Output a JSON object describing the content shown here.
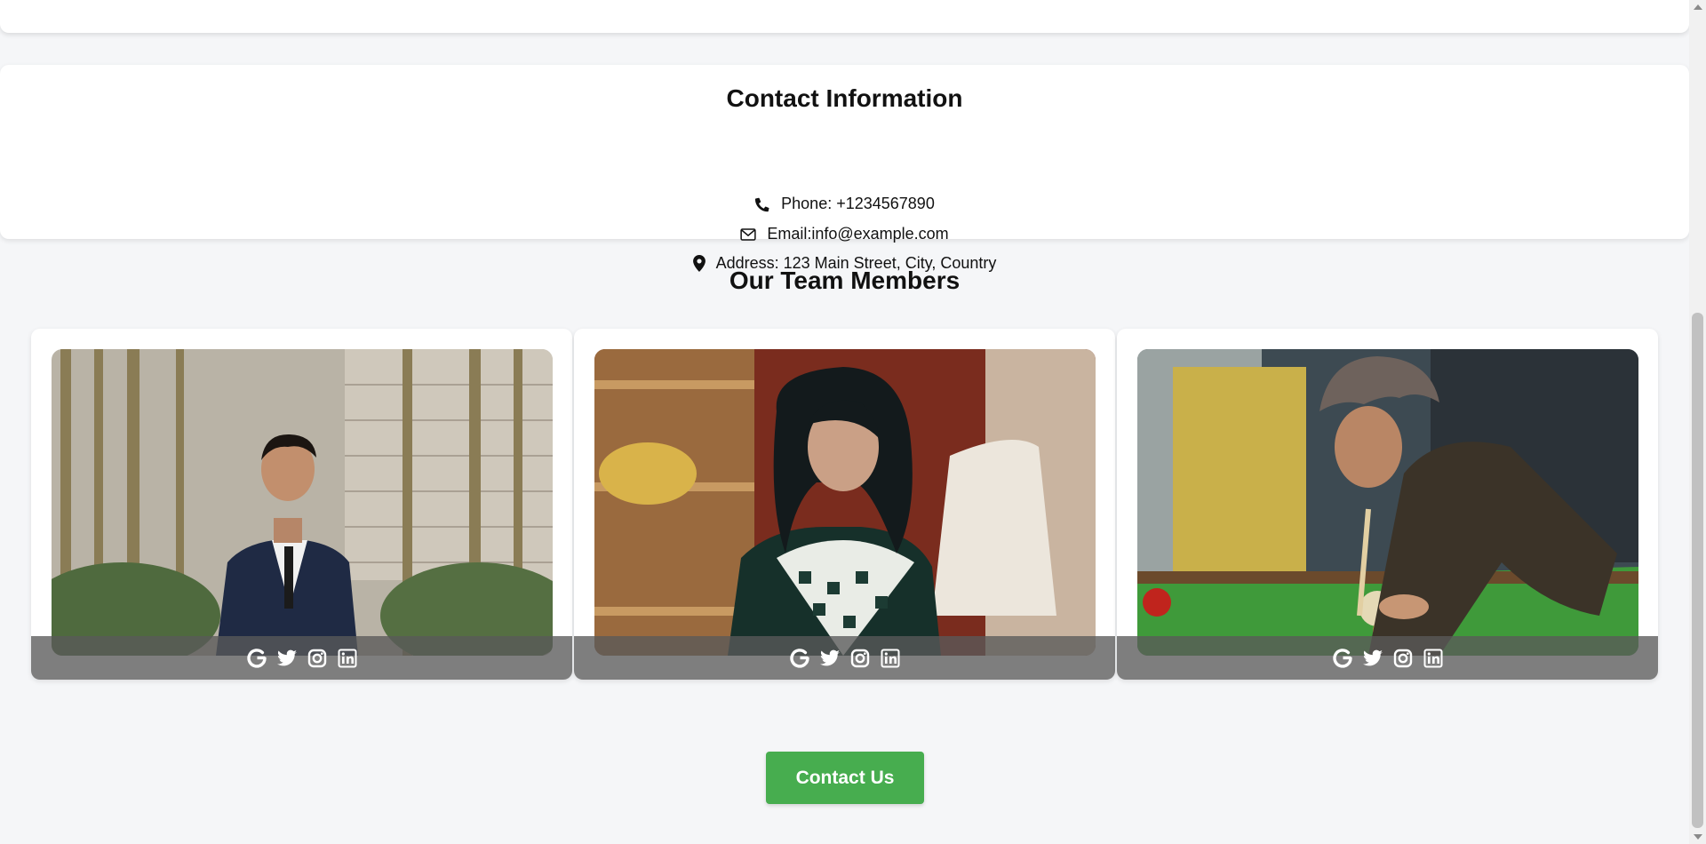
{
  "contact": {
    "title": "Contact Information",
    "phone": "Phone: +1234567890",
    "email": "Email:info@example.com",
    "address": "Address: 123 Main Street, City, Country"
  },
  "team": {
    "title": "Our Team Members",
    "members": [
      {
        "photo": "member-photo-1",
        "social_icons": [
          "google-icon",
          "twitter-icon",
          "instagram-icon",
          "linkedin-icon"
        ]
      },
      {
        "photo": "member-photo-2",
        "social_icons": [
          "google-icon",
          "twitter-icon",
          "instagram-icon",
          "linkedin-icon"
        ]
      },
      {
        "photo": "member-photo-3",
        "social_icons": [
          "google-icon",
          "twitter-icon",
          "instagram-icon",
          "linkedin-icon"
        ]
      }
    ]
  },
  "cta": {
    "label": "Contact Us"
  },
  "colors": {
    "accent": "#47ad4f",
    "page_background": "#f5f6f8",
    "card_background": "#ffffff",
    "overlay": "#5a5a5a"
  }
}
